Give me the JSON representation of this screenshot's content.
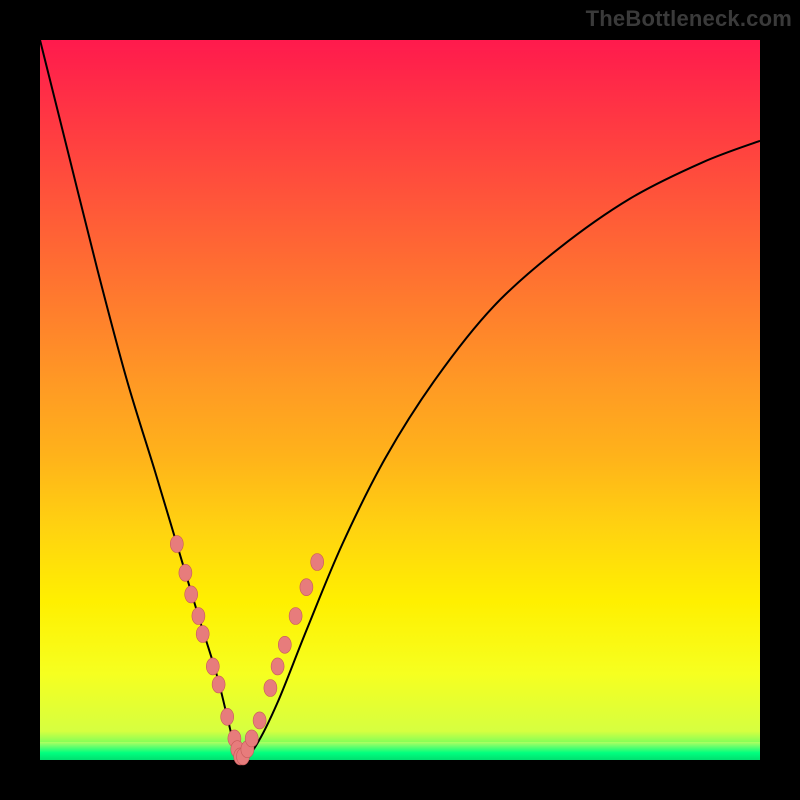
{
  "watermark": "TheBottleneck.com",
  "chart_data": {
    "type": "line",
    "title": "",
    "xlabel": "",
    "ylabel": "",
    "xlim": [
      0,
      100
    ],
    "ylim": [
      0,
      100
    ],
    "grid": false,
    "legend": false,
    "annotations": [],
    "series": [
      {
        "name": "bottleneck-curve",
        "x": [
          0,
          4,
          8,
          12,
          16,
          19,
          22,
          24.5,
          26,
          27,
          28,
          30,
          33,
          37,
          42,
          48,
          55,
          63,
          72,
          82,
          92,
          100
        ],
        "y": [
          100,
          84,
          68,
          53,
          40,
          30,
          20,
          12,
          6,
          2,
          0,
          2,
          8,
          18,
          30,
          42,
          53,
          63,
          71,
          78,
          83,
          86
        ]
      }
    ],
    "markers": [
      {
        "x": 19.0,
        "y": 30.0
      },
      {
        "x": 20.2,
        "y": 26.0
      },
      {
        "x": 21.0,
        "y": 23.0
      },
      {
        "x": 22.0,
        "y": 20.0
      },
      {
        "x": 22.6,
        "y": 17.5
      },
      {
        "x": 24.0,
        "y": 13.0
      },
      {
        "x": 24.8,
        "y": 10.5
      },
      {
        "x": 26.0,
        "y": 6.0
      },
      {
        "x": 27.0,
        "y": 3.0
      },
      {
        "x": 27.4,
        "y": 1.5
      },
      {
        "x": 27.8,
        "y": 0.5
      },
      {
        "x": 28.2,
        "y": 0.5
      },
      {
        "x": 28.8,
        "y": 1.5
      },
      {
        "x": 29.4,
        "y": 3.0
      },
      {
        "x": 30.5,
        "y": 5.5
      },
      {
        "x": 32.0,
        "y": 10.0
      },
      {
        "x": 33.0,
        "y": 13.0
      },
      {
        "x": 34.0,
        "y": 16.0
      },
      {
        "x": 35.5,
        "y": 20.0
      },
      {
        "x": 37.0,
        "y": 24.0
      },
      {
        "x": 38.5,
        "y": 27.5
      }
    ],
    "gradient_stops": [
      {
        "pos": 0,
        "color": "#ff1a4d"
      },
      {
        "pos": 50,
        "color": "#ff9a24"
      },
      {
        "pos": 80,
        "color": "#fff000"
      },
      {
        "pos": 100,
        "color": "#00ff7f"
      }
    ]
  }
}
